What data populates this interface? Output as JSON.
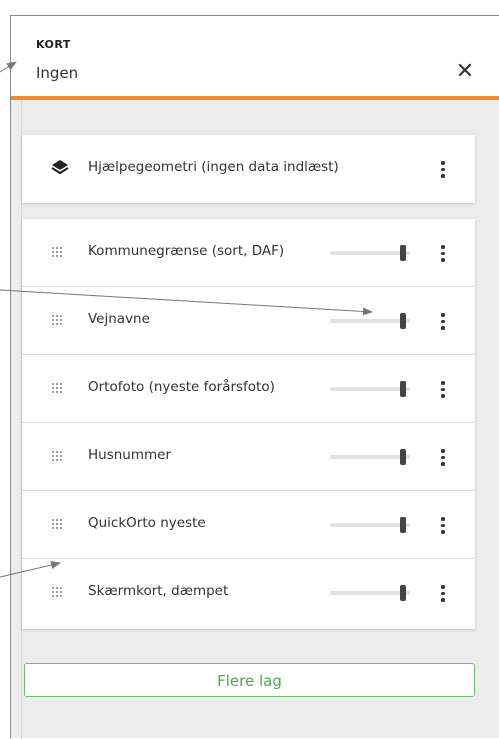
{
  "header": {
    "kicker": "KORT",
    "title": "Ingen",
    "close_glyph": "✕"
  },
  "helper": {
    "label": "Hjælpegeometri (ingen data indlæst)",
    "icon": "layers-icon"
  },
  "layers": [
    {
      "label": "Kommunegrænse (sort, DAF)",
      "opacity": 1.0
    },
    {
      "label": "Vejnavne",
      "opacity": 1.0
    },
    {
      "label": "Ortofoto (nyeste forårsfoto)",
      "opacity": 1.0
    },
    {
      "label": "Husnummer",
      "opacity": 1.0
    },
    {
      "label": "QuickOrto nyeste",
      "opacity": 1.0
    },
    {
      "label": "Skærmkort, dæmpet",
      "opacity": 1.0
    }
  ],
  "footer": {
    "more_layers_label": "Flere lag"
  },
  "colors": {
    "accent_orange": "#f28a2e",
    "button_green": "#4caa4a",
    "panel_bg": "#ececec"
  }
}
